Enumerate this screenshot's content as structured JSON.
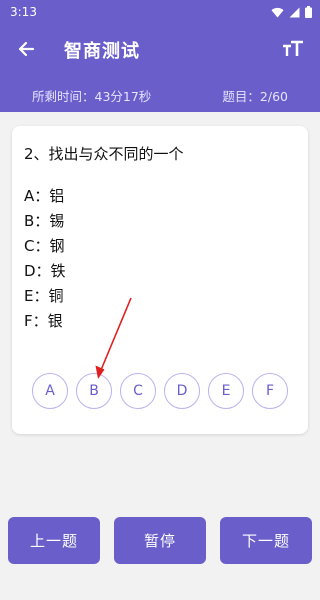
{
  "status_bar": {
    "time": "3:13",
    "icons": [
      "wifi-icon",
      "signal-icon",
      "battery-icon"
    ]
  },
  "app_bar": {
    "title": "智商测试",
    "back_icon": "arrow-left-icon",
    "font_icon": "text-size-icon"
  },
  "info_bar": {
    "time_left": "所剩时间：43分17秒",
    "question_count": "题目：2/60"
  },
  "question": {
    "text": "2、找出与众不同的一个",
    "options": [
      "A：铝",
      "B：锡",
      "C：钢",
      "D：铁",
      "E：铜",
      "F：银"
    ]
  },
  "answer_buttons": [
    "A",
    "B",
    "C",
    "D",
    "E",
    "F"
  ],
  "bottom_buttons": {
    "prev": "上一题",
    "pause": "暂停",
    "next": "下一题"
  },
  "colors": {
    "primary": "#6a5ecb",
    "annotation": "#e02020"
  }
}
